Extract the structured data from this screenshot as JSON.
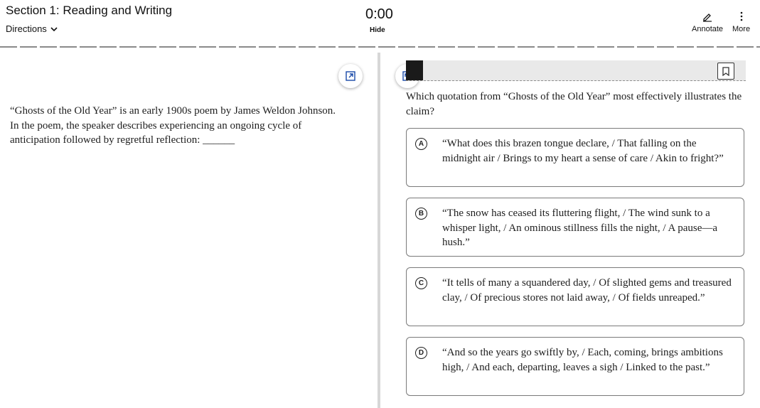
{
  "header": {
    "section_title": "Section 1: Reading and Writing",
    "directions_label": "Directions",
    "timer": "0:00",
    "hide_label": "Hide",
    "annotate_label": "Annotate",
    "more_label": "More"
  },
  "passage": {
    "text": "“Ghosts of the Old Year” is an early 1900s poem by James Weldon Johnson. In the poem, the speaker describes experiencing an ongoing cycle of anticipation followed by regretful reflection: ______"
  },
  "question": {
    "stem": "Which quotation from “Ghosts of the Old Year” most effectively illustrates the claim?",
    "choices": [
      {
        "letter": "A",
        "text": "“What does this brazen tongue declare, / That falling on the midnight air / Brings to my heart a sense of care / Akin to fright?”"
      },
      {
        "letter": "B",
        "text": "“The snow has ceased its fluttering flight, / The wind sunk to a whisper light, / An ominous stillness fills the night, / A pause—a hush.”"
      },
      {
        "letter": "C",
        "text": "“It tells of many a squandered day, / Of slighted gems and treasured clay, / Of precious stores not laid away, / Of fields unreaped.”"
      },
      {
        "letter": "D",
        "text": "“And so the years go swiftly by, / Each, coming, brings ambitions high, / And each, departing, leaves a sigh / Linked to the past.”"
      }
    ]
  },
  "icons": {
    "directions": "chevron-down-icon",
    "annotate": "pencil-icon",
    "more": "kebab-menu-icon",
    "expand": "expand-icon",
    "collapse": "collapse-icon",
    "bookmark": "bookmark-icon"
  },
  "colors": {
    "text": "#1e1e1e",
    "divider": "#d7d7d7",
    "question_bar": "#e9e9e9"
  }
}
